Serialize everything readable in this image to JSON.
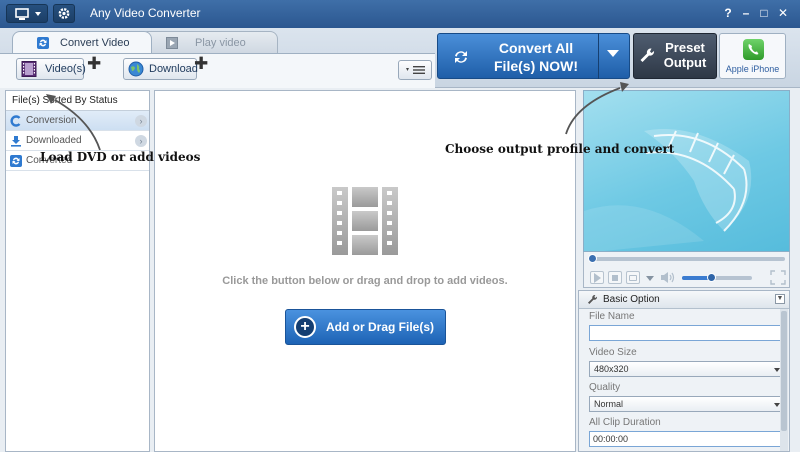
{
  "window": {
    "title": "Any Video Converter",
    "controls": [
      "?",
      "–",
      "□",
      "✕"
    ]
  },
  "tabs": [
    {
      "label": "Convert Video",
      "active": true
    },
    {
      "label": "Play video",
      "active": false
    }
  ],
  "toolbar": {
    "add_videos_label": "Video(s)",
    "download_label": "Download"
  },
  "convert": {
    "line1": "Convert All",
    "line2": "File(s) NOW!"
  },
  "preset": {
    "line1": "Preset",
    "line2": "Output"
  },
  "profile": {
    "name": "Apple iPhone"
  },
  "sidebar": {
    "header": "File(s) Sorted By Status",
    "items": [
      {
        "label": "Conversion",
        "selected": true
      },
      {
        "label": "Downloaded",
        "selected": false
      },
      {
        "label": "Converted",
        "selected": false
      }
    ]
  },
  "main": {
    "hint": "Click the button below or drag and drop to add videos.",
    "add_button": "Add or Drag File(s)"
  },
  "player": {
    "volume_fraction": 0.42
  },
  "basic_option": {
    "title": "Basic Option",
    "file_name_label": "File Name",
    "file_name_value": "",
    "video_size_label": "Video Size",
    "video_size_value": "480x320",
    "quality_label": "Quality",
    "quality_value": "Normal",
    "duration_label": "All Clip Duration",
    "duration_value": "00:00:00"
  },
  "annotations": {
    "left": "Load DVD or add videos",
    "right": "Choose output profile and convert"
  },
  "colors": {
    "titlebar": "#2f5d96",
    "accent": "#1f5ea8",
    "preset": "#3a4554"
  }
}
